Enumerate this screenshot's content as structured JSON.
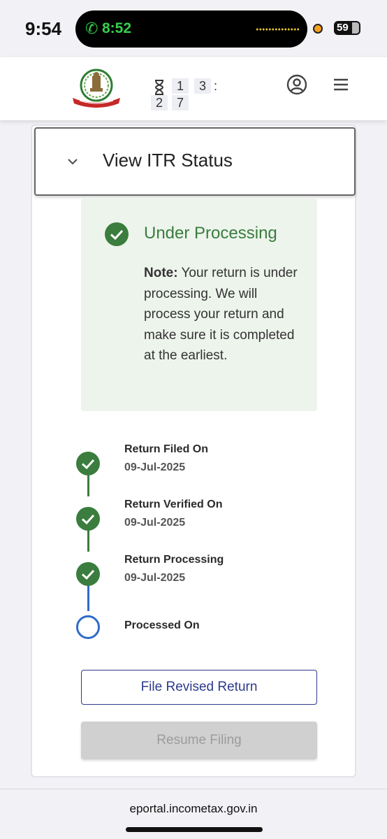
{
  "status_bar": {
    "time": "9:54",
    "call_timer": "8:52",
    "battery": "59"
  },
  "header": {
    "logo_alt": "INCOME TAX DEPARTMENT",
    "timer_digits": [
      "1",
      "3",
      "2",
      "7"
    ],
    "timer_separator": ":"
  },
  "accordion": {
    "title": "View ITR Status"
  },
  "status": {
    "title": "Under Processing",
    "note_label": "Note:",
    "note_text": " Your return is under processing. We will process your return and make sure it is completed at the earliest."
  },
  "timeline": [
    {
      "label": "Return Filed On",
      "date": "09-Jul-2025",
      "state": "done"
    },
    {
      "label": "Return Verified On",
      "date": "09-Jul-2025",
      "state": "done"
    },
    {
      "label": "Return Processing",
      "date": "09-Jul-2025",
      "state": "done"
    },
    {
      "label": "Processed On",
      "date": "",
      "state": "pending"
    }
  ],
  "buttons": {
    "file_revised": "File Revised Return",
    "resume_filing": "Resume Filing"
  },
  "browser": {
    "url": "eportal.incometax.gov.in"
  },
  "colors": {
    "success": "#3a7d3e",
    "pending": "#2f6cc8",
    "primary": "#2c3a8a"
  }
}
